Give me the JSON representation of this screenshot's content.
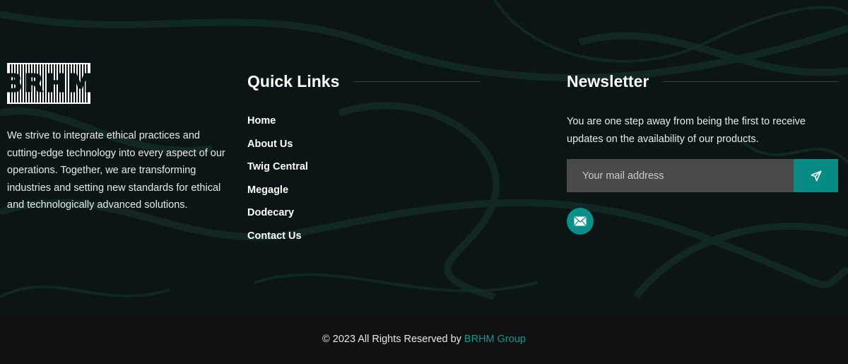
{
  "about": {
    "logo_text": "BRHM",
    "description": "We strive to integrate ethical practices and cutting-edge technology into every aspect of our operations. Together, we are transforming industries and setting new standards for ethical and technologically advanced solutions."
  },
  "quick_links": {
    "heading": "Quick Links",
    "items": [
      {
        "label": "Home"
      },
      {
        "label": "About Us"
      },
      {
        "label": "Twig Central"
      },
      {
        "label": "Megagle"
      },
      {
        "label": "Dodecary"
      },
      {
        "label": "Contact Us"
      }
    ]
  },
  "newsletter": {
    "heading": "Newsletter",
    "text": "You are one step away from being the first to receive updates on the availability of our products.",
    "email_placeholder": "Your mail address",
    "email_value": "",
    "send_icon": "paper-plane-icon",
    "mail_icon": "envelope-icon"
  },
  "copyright": {
    "text": "© 2023 All Rights Reserved by",
    "brand": "BRHM Group"
  },
  "colors": {
    "accent": "#078b85",
    "background": "#0b1516",
    "bottom_bar": "#0f1111",
    "input_bg": "#4a4a4a"
  }
}
